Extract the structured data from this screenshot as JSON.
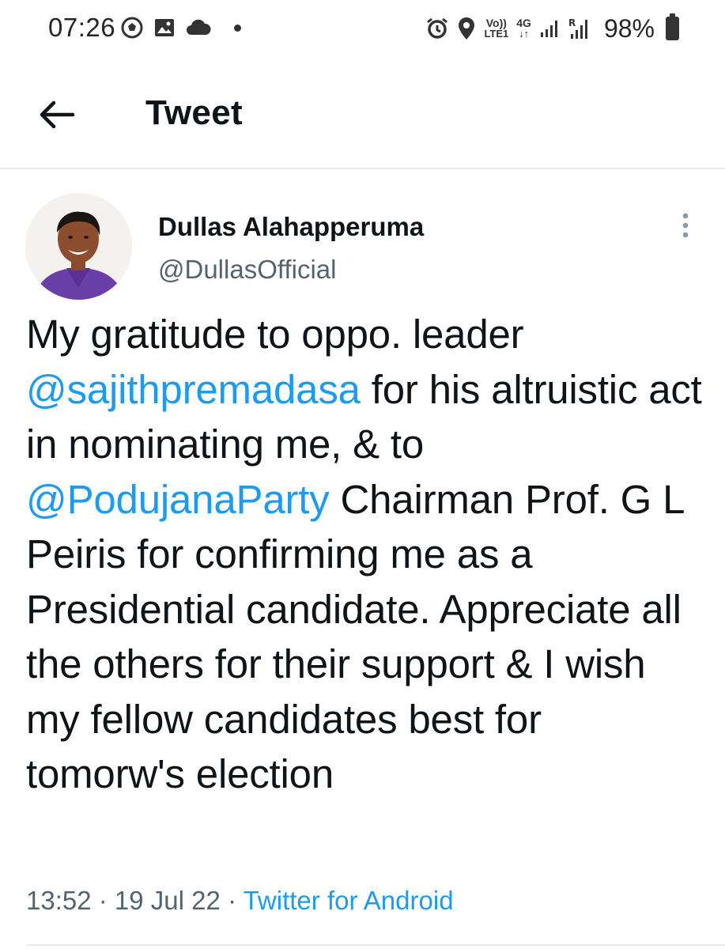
{
  "status_bar": {
    "time": "07:26",
    "left_icons": [
      "football-icon",
      "gallery-icon",
      "cloud-icon",
      "dot-icon"
    ],
    "right_icons": [
      "alarm-icon",
      "location-icon",
      "volte-icon",
      "4g-icon",
      "signal-icon",
      "roaming-signal-icon",
      "battery-icon"
    ],
    "volte_top": "Vo))",
    "volte_bottom": "LTE1",
    "network_type": "4G",
    "battery": "98%"
  },
  "header": {
    "title": "Tweet",
    "back_icon": "arrow-left-icon"
  },
  "tweet": {
    "author_name": "Dullas Alahapperuma",
    "author_handle": "@DullasOfficial",
    "text_segments": [
      {
        "text": "My gratitude to oppo. leader ",
        "mention": false
      },
      {
        "text": "@sajithpremadasa",
        "mention": true
      },
      {
        "text": " for his altruistic act in nominating me, & to ",
        "mention": false
      },
      {
        "text": "@PodujanaParty",
        "mention": true
      },
      {
        "text": " Chairman Prof. G L Peiris for confirming me as a Presidential candidate. Appreciate all the others for their support & I wish my fellow candidates best for tomorw's election",
        "mention": false
      }
    ],
    "time": "13:52",
    "separator": " · ",
    "date": "19 Jul 22",
    "source": "Twitter for Android",
    "more_icon": "more-vertical-icon"
  },
  "colors": {
    "link": "#1d9bf0",
    "secondary_text": "#536471",
    "primary_text": "#0f1419",
    "divider": "#e7e9ea"
  }
}
